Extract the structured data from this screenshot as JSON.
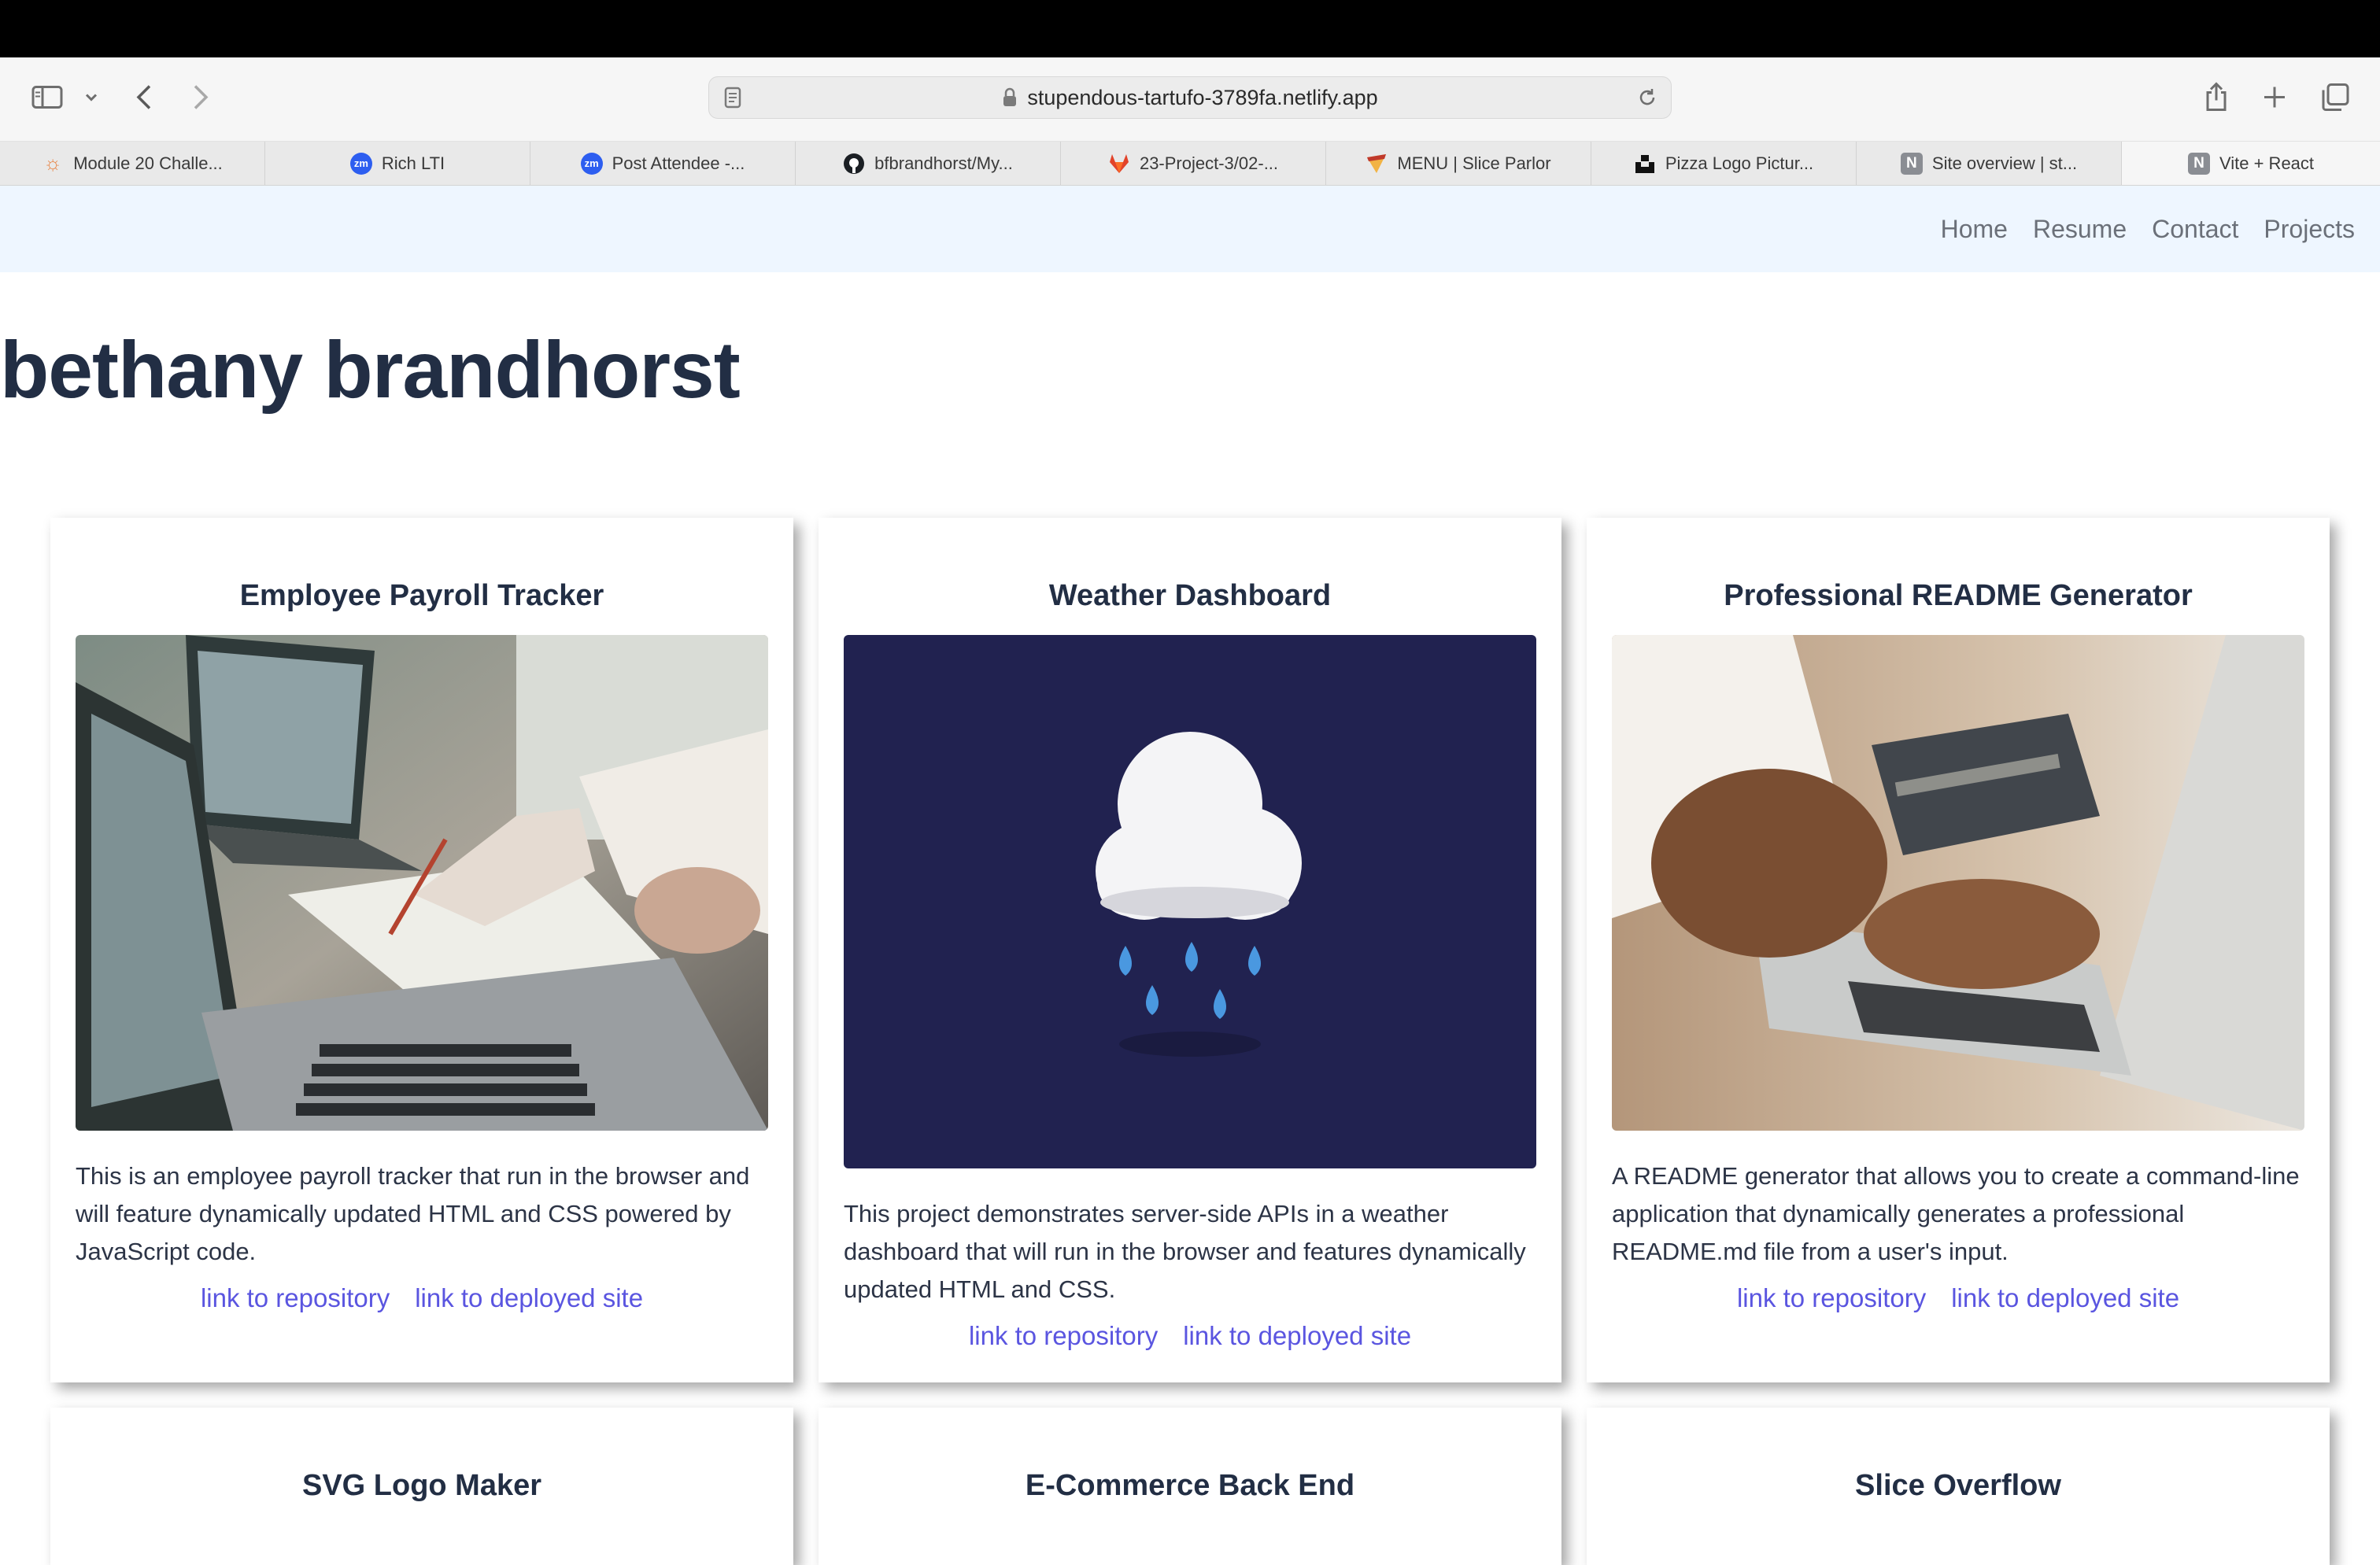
{
  "browser": {
    "url": "stupendous-tartufo-3789fa.netlify.app",
    "tabs": [
      {
        "label": "Module 20 Challe...",
        "icon": "sun-icon"
      },
      {
        "label": "Rich LTI",
        "icon": "zoom-icon"
      },
      {
        "label": "Post Attendee -...",
        "icon": "zoom-icon"
      },
      {
        "label": "bfbrandhorst/My...",
        "icon": "github-icon"
      },
      {
        "label": "23-Project-3/02-...",
        "icon": "gitlab-icon"
      },
      {
        "label": "MENU | Slice Parlor",
        "icon": "slice-parlor-icon"
      },
      {
        "label": "Pizza Logo Pictur...",
        "icon": "unsplash-icon"
      },
      {
        "label": "Site overview | st...",
        "icon": "netlify-icon"
      },
      {
        "label": "Vite + React",
        "icon": "netlify-icon"
      }
    ],
    "zoom_badge": "zm",
    "notion_badge": "N"
  },
  "nav": {
    "home": "Home",
    "resume": "Resume",
    "contact": "Contact",
    "projects": "Projects"
  },
  "page": {
    "title": "bethany brandhorst"
  },
  "projects": [
    {
      "title": "Employee Payroll Tracker",
      "description": "This is an employee payroll tracker that run in the browser and will feature dynamically updated HTML and CSS powered by JavaScript code.",
      "repo_link": "link to repository",
      "site_link": "link to deployed site"
    },
    {
      "title": "Weather Dashboard",
      "description": "This project demonstrates server-side APIs in a weather dashboard that will run in the browser and features dynamically updated HTML and CSS.",
      "repo_link": "link to repository",
      "site_link": "link to deployed site"
    },
    {
      "title": "Professional README Generator",
      "description": "A README generator that allows you to create a command-line application that dynamically generates a professional README.md file from a user's input.",
      "repo_link": "link to repository",
      "site_link": "link to deployed site"
    },
    {
      "title": "SVG Logo Maker"
    },
    {
      "title": "E-Commerce Back End"
    },
    {
      "title": "Slice Overflow"
    }
  ],
  "colors": {
    "nav_bg": "#eef6ff",
    "link": "#5a55e0",
    "heading": "#222e44"
  }
}
